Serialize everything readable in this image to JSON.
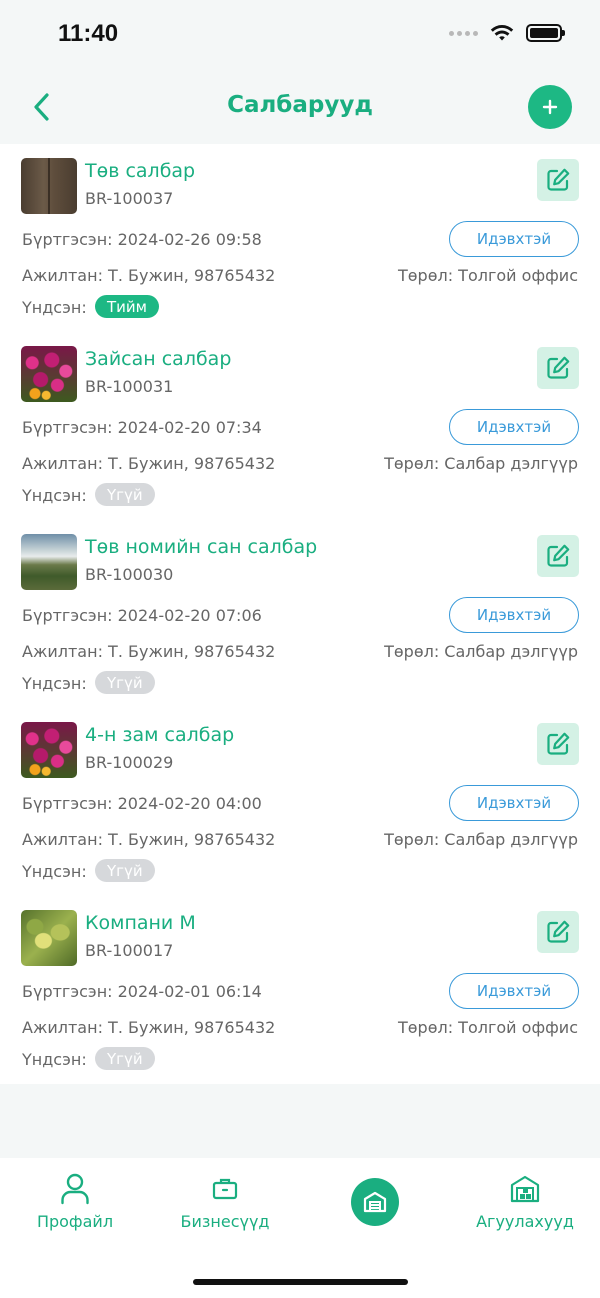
{
  "status_bar": {
    "time": "11:40"
  },
  "header": {
    "title": "Салбарууд"
  },
  "branches": [
    {
      "name": "Төв салбар",
      "code": "BR-100037",
      "registered": "Бүртгэсэн: 2024-02-26 09:58",
      "status": "Идэвхтэй",
      "employee": "Ажилтан: Т. Бужин, 98765432",
      "type": "Төрөл: Толгой оффис",
      "main_label": "Үндсэн:",
      "main_value": "Тийм",
      "is_main": true
    },
    {
      "name": "Зайсан салбар",
      "code": "BR-100031",
      "registered": "Бүртгэсэн: 2024-02-20 07:34",
      "status": "Идэвхтэй",
      "employee": "Ажилтан: Т. Бужин, 98765432",
      "type": "Төрөл: Салбар дэлгүүр",
      "main_label": "Үндсэн:",
      "main_value": "Үгүй",
      "is_main": false
    },
    {
      "name": "Төв номийн сан салбар",
      "code": "BR-100030",
      "registered": "Бүртгэсэн: 2024-02-20 07:06",
      "status": "Идэвхтэй",
      "employee": "Ажилтан: Т. Бужин, 98765432",
      "type": "Төрөл: Салбар дэлгүүр",
      "main_label": "Үндсэн:",
      "main_value": "Үгүй",
      "is_main": false
    },
    {
      "name": "4-н зам салбар",
      "code": "BR-100029",
      "registered": "Бүртгэсэн: 2024-02-20 04:00",
      "status": "Идэвхтэй",
      "employee": "Ажилтан: Т. Бужин, 98765432",
      "type": "Төрөл: Салбар дэлгүүр",
      "main_label": "Үндсэн:",
      "main_value": "Үгүй",
      "is_main": false
    },
    {
      "name": "Компани М",
      "code": "BR-100017",
      "registered": "Бүртгэсэн: 2024-02-01 06:14",
      "status": "Идэвхтэй",
      "employee": "Ажилтан: Т. Бужин, 98765432",
      "type": "Төрөл: Толгой оффис",
      "main_label": "Үндсэн:",
      "main_value": "Үгүй",
      "is_main": false
    }
  ],
  "tab_bar": {
    "profile": "Профайл",
    "businesses": "Бизнесүүд",
    "warehouses": "Агуулахууд"
  },
  "colors": {
    "accent": "#1aae80",
    "status_blue": "#3a9ad9",
    "edit_bg": "#d4f1e5"
  }
}
